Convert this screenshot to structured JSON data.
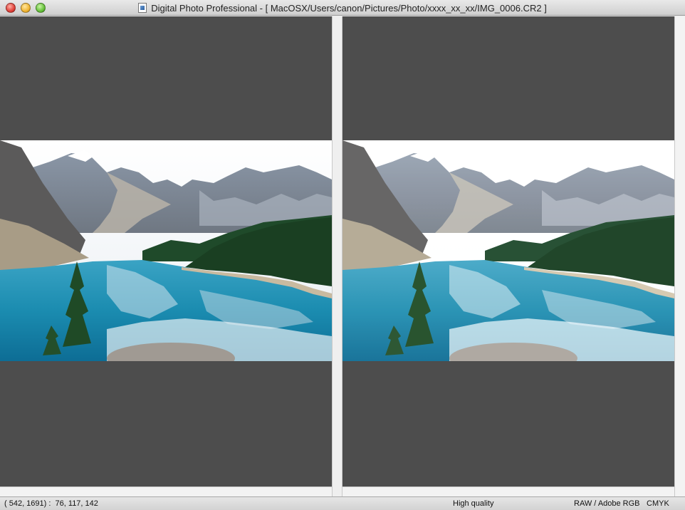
{
  "window": {
    "title": "Digital Photo Professional - [ MacOSX/Users/canon/Pictures/Photo/xxxx_xx_xx/IMG_0006.CR2 ]"
  },
  "status": {
    "coords": "( 542, 1691) :  76, 117, 142",
    "quality": "High quality",
    "color_mode": "RAW / Adobe RGB",
    "cmyk": "CMYK"
  },
  "colors": {
    "pane_background": "#4d4d4d",
    "lake": "#1a8db0",
    "sky": "#f2f5f8"
  }
}
